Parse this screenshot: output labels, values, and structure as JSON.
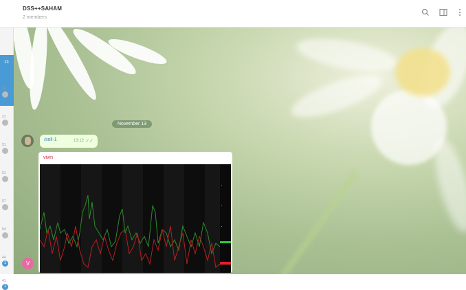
{
  "header": {
    "title": "DSS++SAHAM",
    "subtitle": "2 members",
    "icons": [
      "search-icon",
      "sidebar-toggle-icon",
      "more-vert-icon"
    ]
  },
  "chat_list": {
    "active_label": "13",
    "items": [
      {
        "num": "22",
        "badge": ""
      },
      {
        "num": "21",
        "badge": ""
      },
      {
        "num": "51",
        "badge": ""
      },
      {
        "num": "51",
        "badge": ""
      },
      {
        "num": "57",
        "badge": ""
      },
      {
        "num": "54",
        "badge": ""
      },
      {
        "num": "44",
        "badge": "1"
      },
      {
        "num": "41",
        "badge": "1"
      }
    ]
  },
  "conversation": {
    "date": "November 13",
    "messages": [
      {
        "type": "text",
        "text": "/sell-1",
        "time": "13:12",
        "status": "read"
      },
      {
        "type": "chart",
        "sender": "vivin"
      }
    ],
    "bottom_avatar_initial": "V"
  },
  "colors": {
    "accent": "#4a9ad6",
    "sender_name": "#d0273a",
    "outgoing_bubble": "#eefedf",
    "avatar_pink": "#e66ba3"
  }
}
